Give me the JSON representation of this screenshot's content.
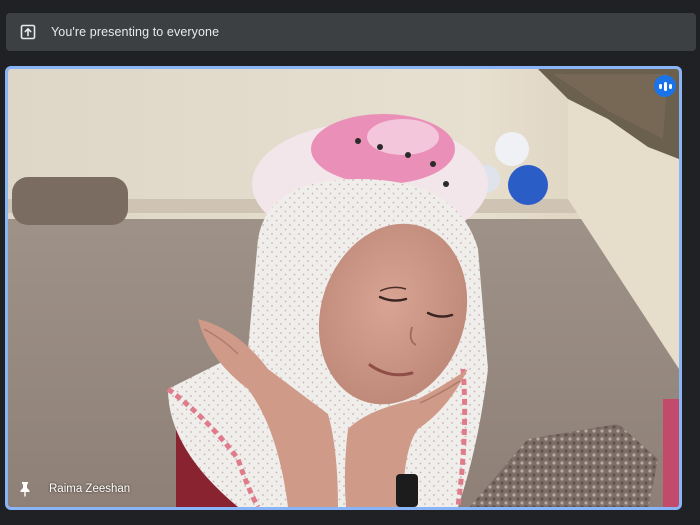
{
  "banner": {
    "text": "You're presenting to everyone",
    "icon": "present-to-all-icon"
  },
  "participant": {
    "name": "Raima Zeeshan",
    "pin_icon": "pin-icon",
    "audio_icon": "audio-level-icon",
    "speaking": true,
    "video_image": "girl in a pink hat and white scarf holding her face with both hands"
  },
  "colors": {
    "background": "#202124",
    "banner": "#3c4043",
    "active_border": "#8ab4f8",
    "audio_badge": "#1a73e8"
  }
}
